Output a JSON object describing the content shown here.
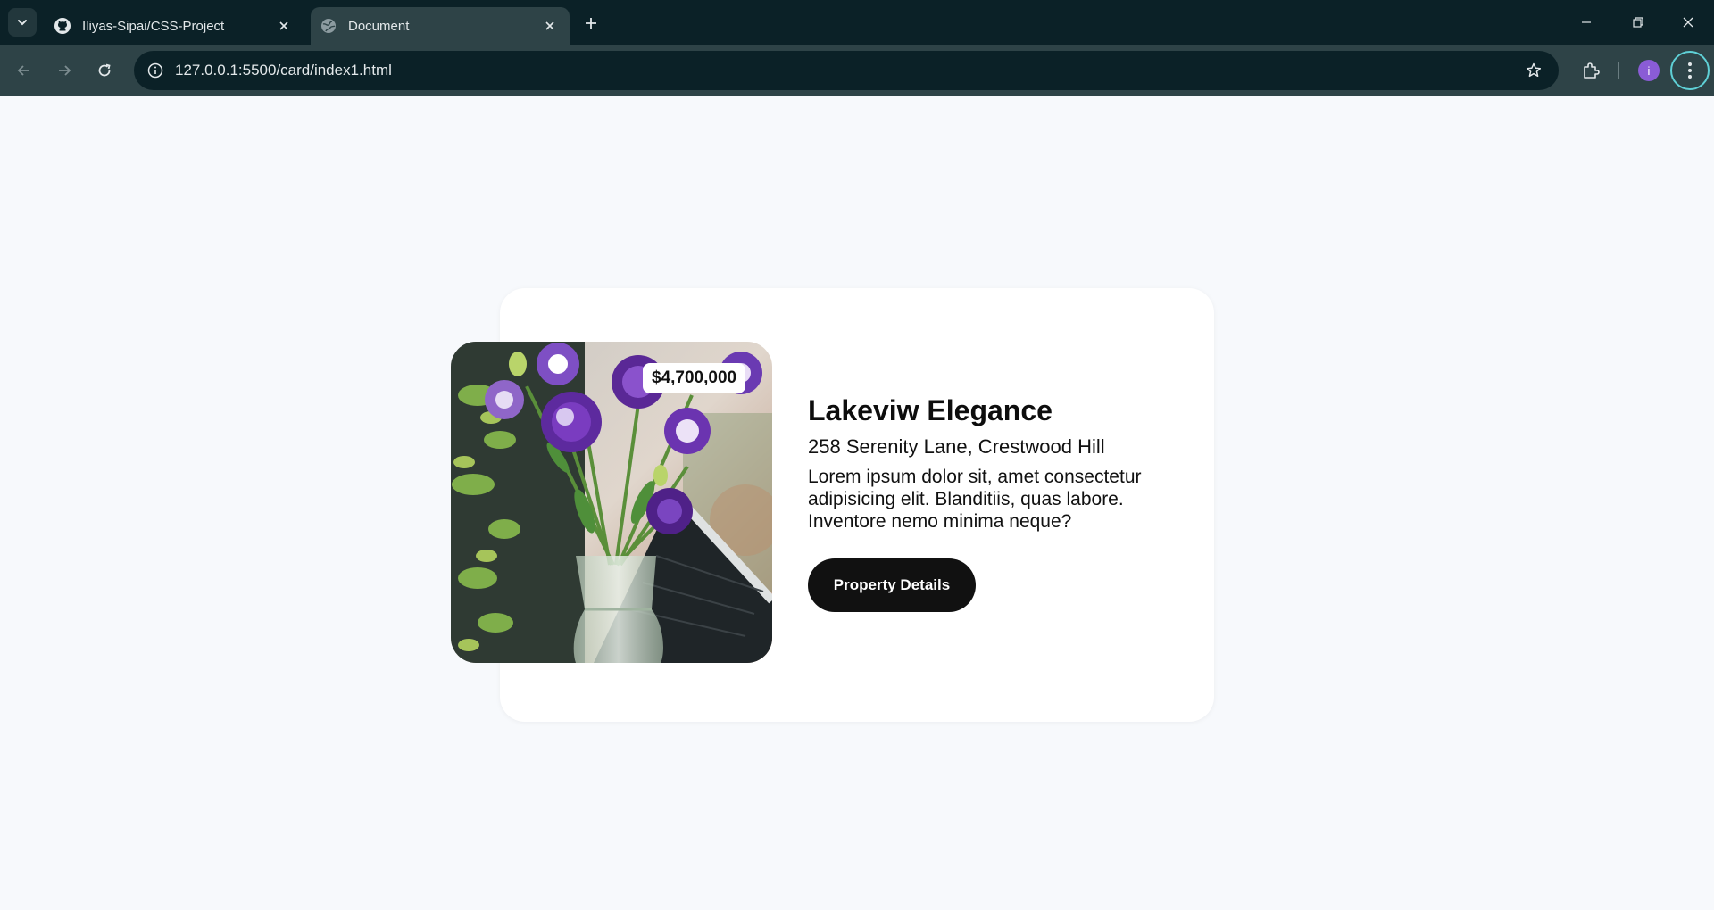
{
  "browser": {
    "tabs": [
      {
        "title": "Iliyas-Sipai/CSS-Project",
        "icon": "github-icon"
      },
      {
        "title": "Document",
        "icon": "globe-icon"
      }
    ],
    "url": "127.0.0.1:5500/card/index1.html",
    "profile_initial": "i",
    "colors": {
      "tabbar": "#0b2127",
      "toolbar": "#2e4347",
      "avatar": "#8a5cd6"
    }
  },
  "card": {
    "price": "$4,700,000",
    "title": "Lakeviw Elegance",
    "address": "258 Serenity Lane, Crestwood Hill",
    "description": "Lorem ipsum dolor sit, amet consectetur adipisicing elit. Blanditiis, quas labore. Inventore nemo minima neque?",
    "button_label": "Property Details",
    "image_subject": "purple-lisianthus-flowers-in-glass-vase"
  }
}
